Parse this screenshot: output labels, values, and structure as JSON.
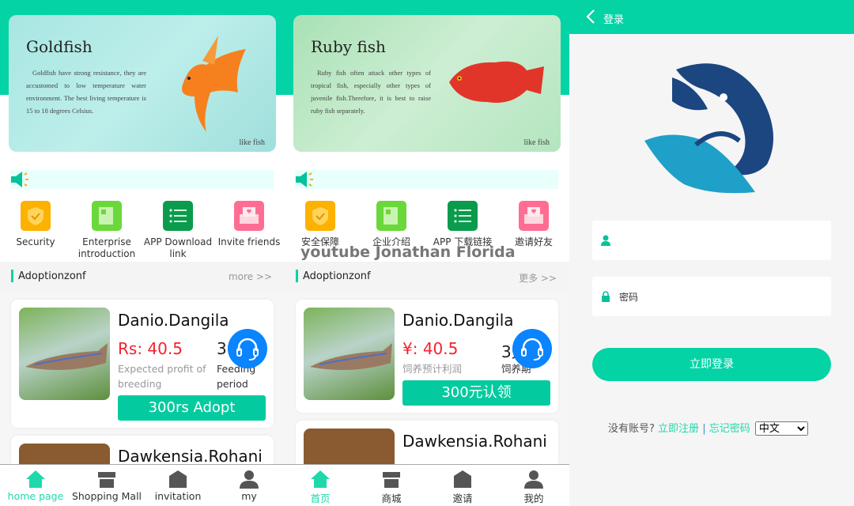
{
  "watermark": "youtube Jonathan Florida",
  "en": {
    "banner": {
      "title": "Goldfish",
      "text": "Goldfish have strong resistance, they are accustomed to low temperature water environment. The best living temperature is 15 to 18 degrees Celsius.",
      "tag": "like fish"
    },
    "icons": [
      "Security",
      "Enterprise introduction",
      "APP Download link",
      "Invite friends"
    ],
    "section": {
      "title": "Adoptionzonf",
      "more": "more >>"
    },
    "cards": [
      {
        "name": "Danio.Dangila",
        "price": "Rs: 40.5",
        "days": "30",
        "profit_label": "Expected profit of breeding",
        "period_label": "Feeding period",
        "button": "300rs Adopt"
      },
      {
        "name": "Dawkensia.Rohani"
      }
    ],
    "nav": [
      "home page",
      "Shopping Mall",
      "invitation",
      "my"
    ]
  },
  "zh": {
    "banner": {
      "title": "Ruby fish",
      "text": "Ruby fish often attack other types of tropical fish, especially other types of juvenile fish.Therefore, it is best to raise ruby fish separately.",
      "tag": "like fish"
    },
    "icons": [
      "安全保障",
      "企业介绍",
      "APP 下载链接",
      "邀请好友"
    ],
    "section": {
      "title": "Adoptionzonf",
      "more": "更多 >>"
    },
    "cards": [
      {
        "name": "Danio.Dangila",
        "price": "¥: 40.5",
        "days": "3天",
        "profit_label": "饲养预计利润",
        "period_label": "饲养期",
        "button": "300元认领"
      },
      {
        "name": "Dawkensia.Rohani"
      }
    ],
    "nav": [
      "首页",
      "商城",
      "邀请",
      "我的"
    ]
  },
  "login": {
    "title": "登录",
    "username_placeholder": "",
    "password_label": "密码",
    "submit": "立即登录",
    "no_account": "没有账号?",
    "register": "立即注册",
    "separator": "|",
    "forgot": "忘记密码",
    "language": "中文"
  },
  "colors": {
    "accent": "#04d3a6",
    "price": "#f5222d",
    "service": "#0a84ff"
  }
}
